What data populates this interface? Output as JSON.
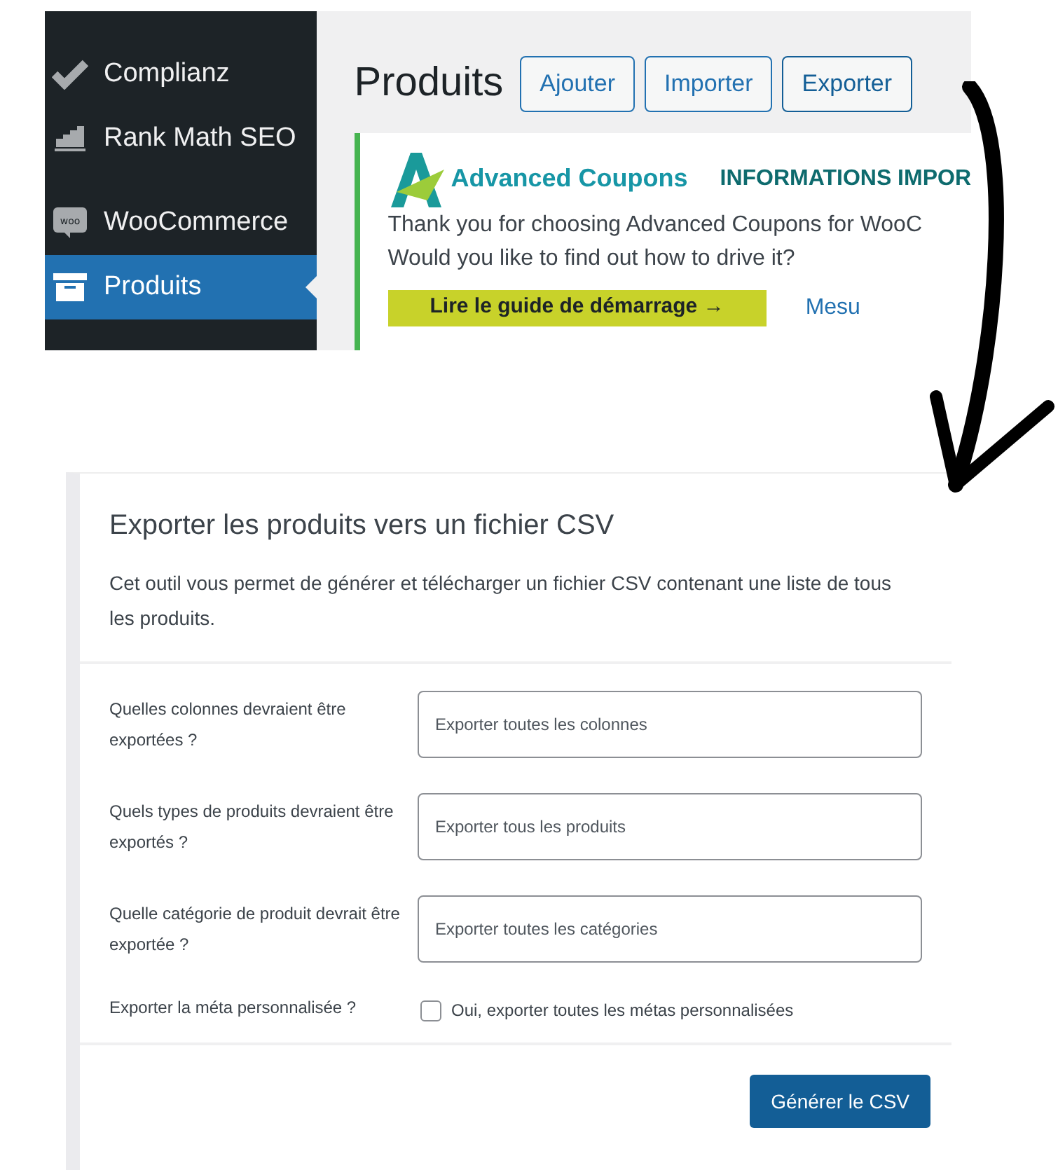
{
  "sidebar": {
    "items": [
      {
        "kind": "check",
        "label": "Complianz",
        "selected": false
      },
      {
        "kind": "chart",
        "label": "Rank Math SEO",
        "selected": false
      },
      {
        "kind": "woo",
        "label": "WooCommerce",
        "selected": false
      },
      {
        "kind": "box",
        "label": "Produits",
        "selected": true
      }
    ]
  },
  "header": {
    "title": "Produits",
    "buttons": [
      {
        "label": "Ajouter",
        "selected": false
      },
      {
        "label": "Importer",
        "selected": false
      },
      {
        "label": "Exporter",
        "selected": true
      }
    ]
  },
  "notice": {
    "brand": "Advanced Coupons",
    "heading": "INFORMATIONS IMPOR",
    "text": "Thank you for choosing Advanced Coupons for WooC",
    "text_2": "Would you like to find out how to drive it?",
    "button": "Lire le guide de démarrage →",
    "link": "Mesu"
  },
  "export": {
    "title": "Exporter les produits vers un fichier CSV",
    "description": "Cet outil vous permet de générer et télécharger un fichier CSV contenant une liste de tous les produits.",
    "fields": [
      {
        "kind": "select",
        "label": "Quelles colonnes devraient être exportées ?",
        "placeholder": "Exporter toutes les colonnes"
      },
      {
        "kind": "select",
        "label": "Quels types de produits devraient être exportés ?",
        "placeholder": "Exporter tous les produits"
      },
      {
        "kind": "select",
        "label": "Quelle catégorie de produit devrait être exportée ?",
        "placeholder": "Exporter toutes les catégories"
      },
      {
        "kind": "checkbox",
        "label": "Exporter la méta personnalisée ?",
        "option": "Oui, exporter toutes les métas personnalisées",
        "checked": false
      }
    ],
    "button": "Générer le CSV"
  }
}
